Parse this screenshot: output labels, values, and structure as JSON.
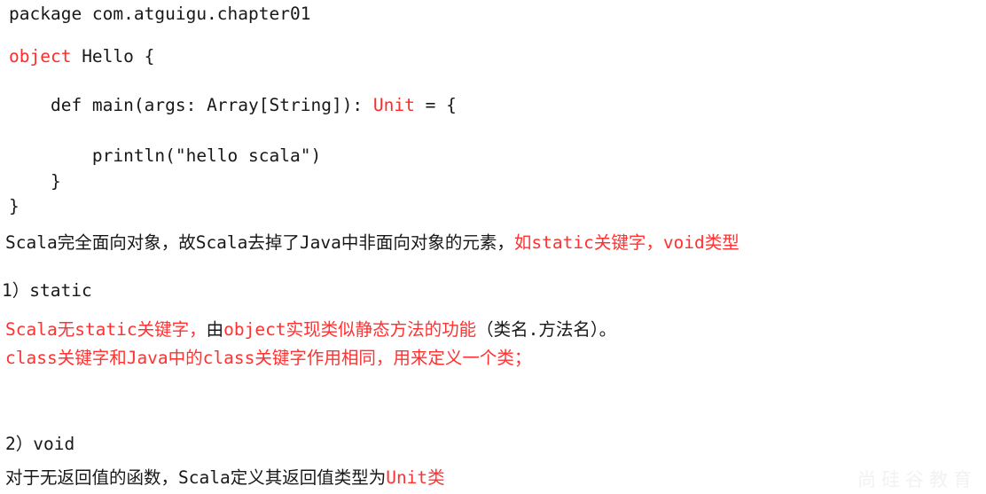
{
  "document": {
    "language": "scala",
    "background_color": "#ffffff",
    "text_color": "#181818",
    "accent_color": "#ff2b2b"
  },
  "code": {
    "package_line": "package com.atguigu.chapter01",
    "object_keyword": "object",
    "object_rest": " Hello {",
    "def_indent": "    ",
    "def_signature": "def main(args: Array[String]): ",
    "unit_keyword": "Unit",
    "def_tail": " = {",
    "println_line": "        println(\"hello scala\")",
    "close_inner": "    }",
    "close_outer": "}"
  },
  "prose": {
    "oo_black": "Scala完全面向对象，故Scala去掉了Java中非面向对象的元素，",
    "oo_red": "如static关键字，void类型",
    "section1_heading": "1）static",
    "section1_line1_red_a": "Scala无static关键字，",
    "section1_line1_black_a": "由",
    "section1_line1_red_b": "object实现类似静态方法的功能",
    "section1_line1_black_b": "（类名.方法名）。",
    "section1_line2_red": "class关键字和Java中的class关键字作用相同，用来定义一个类；",
    "section2_heading": "2）void",
    "section2_line1_black": "对于无返回值的函数，Scala定义其返回值类型为",
    "section2_line1_red": "Unit类"
  },
  "watermark": {
    "text": "尚硅谷教育"
  }
}
